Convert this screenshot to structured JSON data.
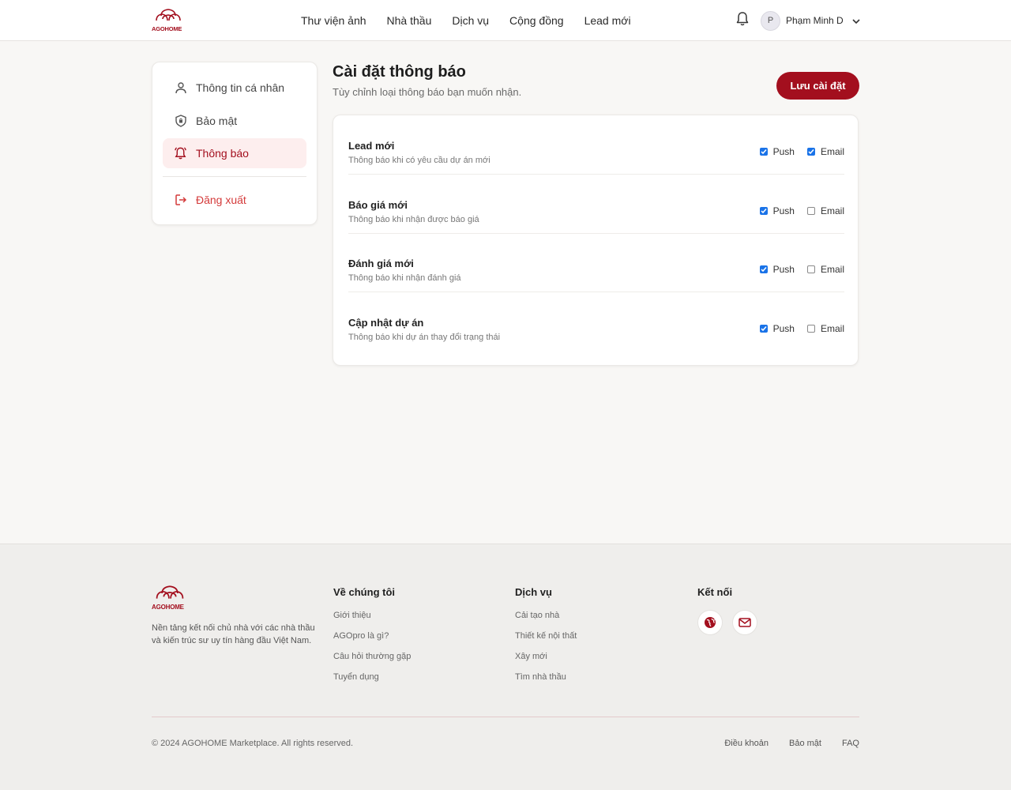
{
  "brand": {
    "logo_text": "AGOHOME",
    "accent": "#a30f1e"
  },
  "header": {
    "nav": [
      "Thư viện ảnh",
      "Nhà thầu",
      "Dịch vụ",
      "Cộng đồng",
      "Lead mới"
    ],
    "avatar_initial": "P",
    "user_name": "Phạm Minh D"
  },
  "sidebar": {
    "items": [
      {
        "label": "Thông tin cá nhân",
        "icon": "user-icon"
      },
      {
        "label": "Bảo mật",
        "icon": "shield-icon"
      },
      {
        "label": "Thông báo",
        "icon": "bell-icon",
        "active": true
      }
    ],
    "logout": {
      "label": "Đăng xuất",
      "icon": "logout-icon"
    }
  },
  "main": {
    "title": "Cài đặt thông báo",
    "subtitle": "Tùy chỉnh loại thông báo bạn muốn nhận.",
    "save_label": "Lưu cài đặt",
    "rows": [
      {
        "title": "Lead mới",
        "desc": "Thông báo khi có yêu cầu dự án mới",
        "push": true,
        "email": true
      },
      {
        "title": "Báo giá mới",
        "desc": "Thông báo khi nhận được báo giá",
        "push": true,
        "email": false
      },
      {
        "title": "Đánh giá mới",
        "desc": "Thông báo khi nhận đánh giá",
        "push": true,
        "email": false
      },
      {
        "title": "Cập nhật dự án",
        "desc": "Thông báo khi dự án thay đổi trạng thái",
        "push": true,
        "email": false
      }
    ],
    "push_label": "Push",
    "email_label": "Email"
  },
  "footer": {
    "logo_text": "AGOHOME",
    "description": "Nền tảng kết nối chủ nhà với các nhà thầu và kiến trúc sư uy tín hàng đầu Việt Nam.",
    "about": {
      "heading": "Về chúng tôi",
      "links": [
        "Giới thiệu",
        "AGOpro là gì?",
        "Câu hỏi thường gặp",
        "Tuyển dụng"
      ]
    },
    "services": {
      "heading": "Dịch vụ",
      "links": [
        "Cải tạo nhà",
        "Thiết kế nội thất",
        "Xây mới",
        "Tìm nhà thầu"
      ]
    },
    "connect": {
      "heading": "Kết nối",
      "icons": [
        "globe-icon",
        "mail-icon"
      ]
    },
    "copyright": "© 2024 AGOHOME Marketplace. All rights reserved.",
    "legal": [
      "Điều khoản",
      "Bảo mật",
      "FAQ"
    ]
  }
}
